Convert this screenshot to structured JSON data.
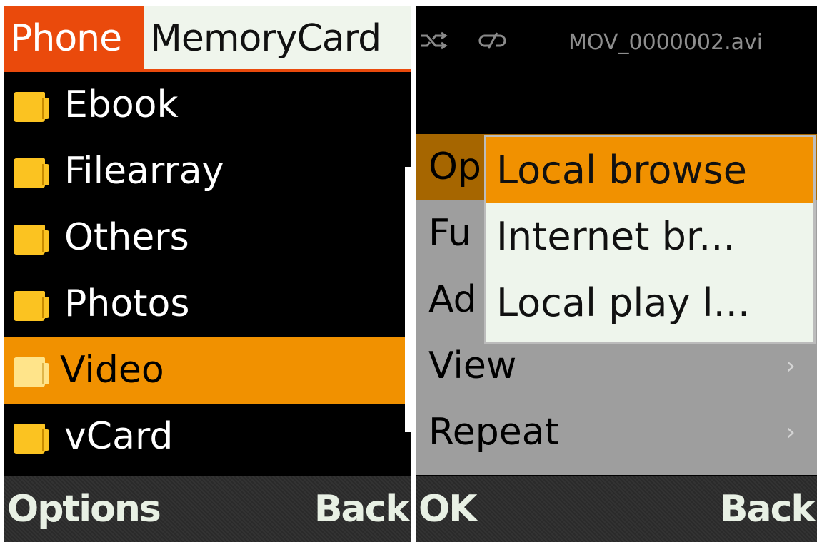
{
  "left": {
    "tabs": {
      "active": "Phone",
      "inactive": "MemoryCard"
    },
    "folders": [
      {
        "label": "Ebook"
      },
      {
        "label": "Filearray"
      },
      {
        "label": "Others"
      },
      {
        "label": "Photos"
      },
      {
        "label": "Video",
        "selected": true
      },
      {
        "label": "vCard"
      }
    ],
    "softkeys": {
      "left": "Options",
      "right": "Back"
    },
    "colors": {
      "accent": "#ea4a0c",
      "selection": "#f19100",
      "folder": "#fbc321"
    }
  },
  "right": {
    "status": {
      "shuffle_icon": "shuffle-icon",
      "repeat_icon": "repeat-off-icon",
      "filename": "MOV_0000002.avi"
    },
    "menu": [
      {
        "label": "Op"
      },
      {
        "label": "Fu"
      },
      {
        "label": "Ad"
      },
      {
        "label": "View",
        "has_submenu": true
      },
      {
        "label": "Repeat",
        "has_submenu": true
      }
    ],
    "submenu": [
      {
        "label": "Local browse",
        "selected": true
      },
      {
        "label": "Internet br..."
      },
      {
        "label": "Local play l..."
      }
    ],
    "softkeys": {
      "left": "OK",
      "right": "Back"
    },
    "colors": {
      "menu_bg": "#9e9e9e",
      "highlight": "#f19100",
      "submenu_bg": "#eef5ec"
    }
  }
}
